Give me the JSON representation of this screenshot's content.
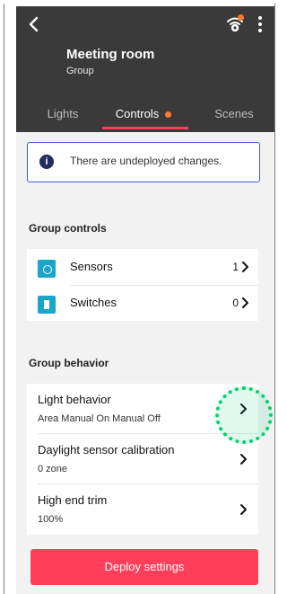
{
  "header": {
    "title": "Meeting room",
    "subtitle": "Group",
    "icons": {
      "back": "back-icon",
      "hub": "hub-icon",
      "more": "more-vertical-icon"
    }
  },
  "tabs": [
    {
      "label": "Lights"
    },
    {
      "label": "Controls",
      "badge": true
    },
    {
      "label": "Scenes"
    }
  ],
  "alert": {
    "text": "There are undeployed changes.",
    "icon": "info-icon"
  },
  "group_controls": {
    "title": "Group controls",
    "items": [
      {
        "label": "Sensors",
        "count": "1",
        "icon": "sensor-icon"
      },
      {
        "label": "Switches",
        "count": "0",
        "icon": "switch-icon"
      }
    ]
  },
  "group_behavior": {
    "title": "Group behavior",
    "items": [
      {
        "title": "Light behavior",
        "value": "Area Manual On Manual Off"
      },
      {
        "title": "Daylight sensor calibration",
        "value": "0 zone"
      },
      {
        "title": "High end trim",
        "value": "100%"
      }
    ]
  },
  "deploy_button": {
    "label": "Deploy settings"
  },
  "colors": {
    "accent": "#ff3f5a",
    "badge": "#ff7a30",
    "header_bg": "#3a3a3a",
    "alert_border": "#3f5bd8",
    "control_icon": "#1aa6c9",
    "highlight": "#00d16a"
  }
}
